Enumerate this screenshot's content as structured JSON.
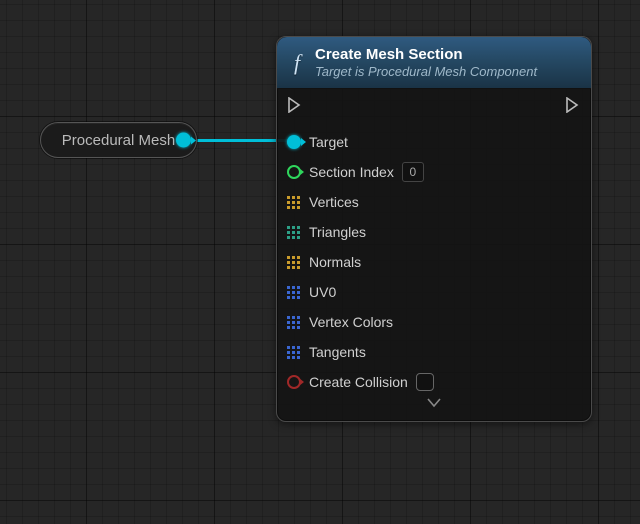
{
  "source_node": {
    "label": "Procedural Mesh"
  },
  "func_node": {
    "icon_glyph": "f",
    "title": "Create Mesh Section",
    "subtitle": "Target is Procedural Mesh Component",
    "pins": {
      "target": "Target",
      "section_index": "Section Index",
      "section_index_value": "0",
      "vertices": "Vertices",
      "triangles": "Triangles",
      "normals": "Normals",
      "uv0": "UV0",
      "vertex_colors": "Vertex Colors",
      "tangents": "Tangents",
      "create_collision": "Create Collision"
    }
  }
}
